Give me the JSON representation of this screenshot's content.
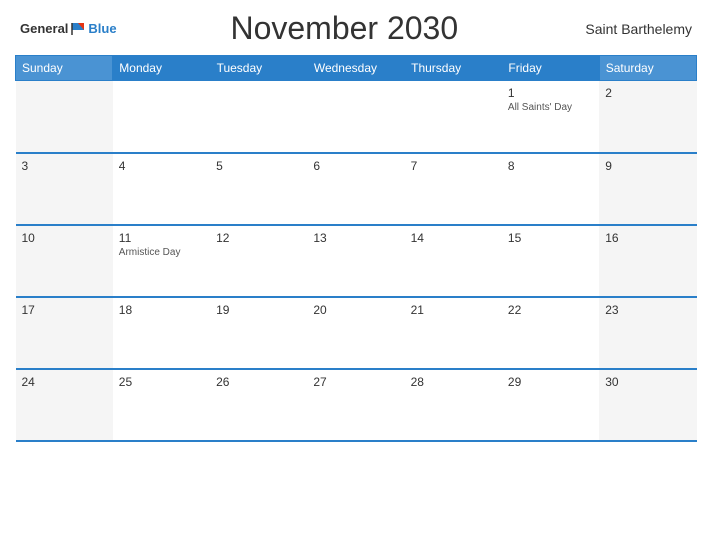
{
  "header": {
    "logo_general": "General",
    "logo_blue": "Blue",
    "title": "November 2030",
    "region": "Saint Barthelemy"
  },
  "weekdays": [
    "Sunday",
    "Monday",
    "Tuesday",
    "Wednesday",
    "Thursday",
    "Friday",
    "Saturday"
  ],
  "weeks": [
    [
      {
        "day": "",
        "event": ""
      },
      {
        "day": "",
        "event": ""
      },
      {
        "day": "",
        "event": ""
      },
      {
        "day": "",
        "event": ""
      },
      {
        "day": "",
        "event": ""
      },
      {
        "day": "1",
        "event": "All Saints' Day"
      },
      {
        "day": "2",
        "event": ""
      }
    ],
    [
      {
        "day": "3",
        "event": ""
      },
      {
        "day": "4",
        "event": ""
      },
      {
        "day": "5",
        "event": ""
      },
      {
        "day": "6",
        "event": ""
      },
      {
        "day": "7",
        "event": ""
      },
      {
        "day": "8",
        "event": ""
      },
      {
        "day": "9",
        "event": ""
      }
    ],
    [
      {
        "day": "10",
        "event": ""
      },
      {
        "day": "11",
        "event": "Armistice Day"
      },
      {
        "day": "12",
        "event": ""
      },
      {
        "day": "13",
        "event": ""
      },
      {
        "day": "14",
        "event": ""
      },
      {
        "day": "15",
        "event": ""
      },
      {
        "day": "16",
        "event": ""
      }
    ],
    [
      {
        "day": "17",
        "event": ""
      },
      {
        "day": "18",
        "event": ""
      },
      {
        "day": "19",
        "event": ""
      },
      {
        "day": "20",
        "event": ""
      },
      {
        "day": "21",
        "event": ""
      },
      {
        "day": "22",
        "event": ""
      },
      {
        "day": "23",
        "event": ""
      }
    ],
    [
      {
        "day": "24",
        "event": ""
      },
      {
        "day": "25",
        "event": ""
      },
      {
        "day": "26",
        "event": ""
      },
      {
        "day": "27",
        "event": ""
      },
      {
        "day": "28",
        "event": ""
      },
      {
        "day": "29",
        "event": ""
      },
      {
        "day": "30",
        "event": ""
      }
    ]
  ]
}
